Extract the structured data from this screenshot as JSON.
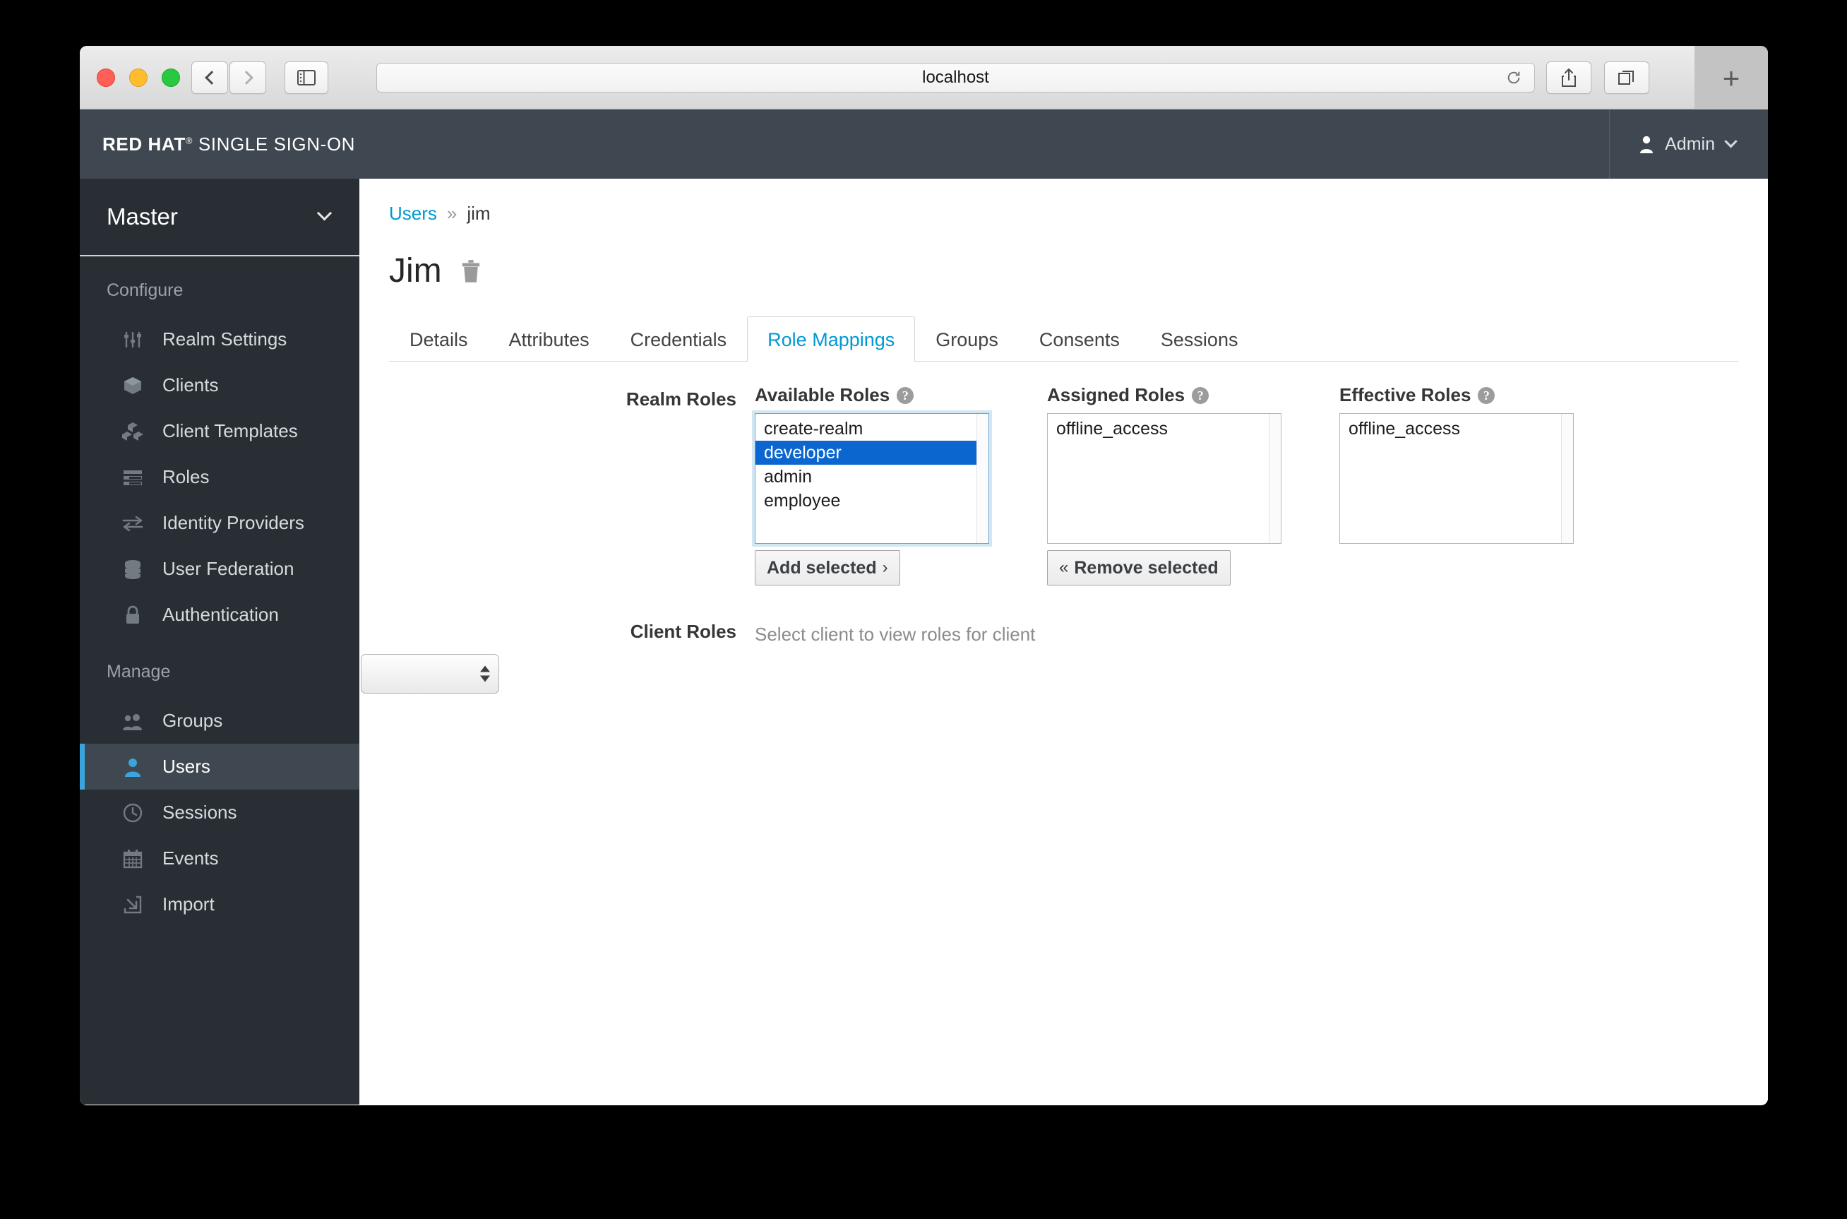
{
  "browser": {
    "url": "localhost",
    "back_icon": "chevron-left-icon",
    "forward_icon": "chevron-right-icon",
    "sidebar_icon": "sidebar-toggle-icon",
    "reload_icon": "reload-icon",
    "share_icon": "share-icon",
    "tabs_icon": "show-tabs-icon",
    "new_tab_label": "+"
  },
  "header": {
    "brand_bold": "RED HAT",
    "brand_sup": "®",
    "brand_regular": "SINGLE SIGN-ON",
    "user_label": "Admin",
    "user_icon": "user-icon",
    "caret_icon": "chevron-down-icon"
  },
  "sidebar": {
    "realm": "Master",
    "realm_caret_icon": "chevron-down-icon",
    "groups": [
      {
        "title": "Configure",
        "items": [
          {
            "label": "Realm Settings",
            "icon": "sliders-icon",
            "active": false
          },
          {
            "label": "Clients",
            "icon": "cube-icon",
            "active": false
          },
          {
            "label": "Client Templates",
            "icon": "cubes-icon",
            "active": false
          },
          {
            "label": "Roles",
            "icon": "list-bars-icon",
            "active": false
          },
          {
            "label": "Identity Providers",
            "icon": "exchange-arrows-icon",
            "active": false
          },
          {
            "label": "User Federation",
            "icon": "database-icon",
            "active": false
          },
          {
            "label": "Authentication",
            "icon": "lock-icon",
            "active": false
          }
        ]
      },
      {
        "title": "Manage",
        "items": [
          {
            "label": "Groups",
            "icon": "users-group-icon",
            "active": false
          },
          {
            "label": "Users",
            "icon": "user-icon",
            "active": true
          },
          {
            "label": "Sessions",
            "icon": "clock-icon",
            "active": false
          },
          {
            "label": "Events",
            "icon": "calendar-icon",
            "active": false
          },
          {
            "label": "Import",
            "icon": "import-arrow-icon",
            "active": false
          }
        ]
      }
    ]
  },
  "content": {
    "breadcrumb": {
      "parent": "Users",
      "separator": "»",
      "current": "jim"
    },
    "page_title": "Jim",
    "delete_icon": "trash-icon",
    "tabs": [
      {
        "label": "Details",
        "active": false
      },
      {
        "label": "Attributes",
        "active": false
      },
      {
        "label": "Credentials",
        "active": false
      },
      {
        "label": "Role Mappings",
        "active": true
      },
      {
        "label": "Groups",
        "active": false
      },
      {
        "label": "Consents",
        "active": false
      },
      {
        "label": "Sessions",
        "active": false
      }
    ],
    "realm_roles": {
      "label": "Realm Roles",
      "available": {
        "label": "Available Roles",
        "help_icon": "question-circle-icon",
        "items": [
          "create-realm",
          "developer",
          "admin",
          "employee"
        ],
        "selected": [
          "developer"
        ],
        "focused": true
      },
      "add_button": {
        "label": "Add selected",
        "arrow": "›"
      },
      "assigned": {
        "label": "Assigned Roles",
        "help_icon": "question-circle-icon",
        "items": [
          "offline_access"
        ],
        "selected": []
      },
      "remove_button": {
        "arrow": "«",
        "label": "Remove selected"
      },
      "effective": {
        "label": "Effective Roles",
        "help_icon": "question-circle-icon",
        "items": [
          "offline_access"
        ],
        "selected": []
      }
    },
    "client_roles": {
      "label": "Client Roles",
      "select_value": "",
      "hint": "Select client to view roles for client"
    }
  },
  "colors": {
    "accent_blue": "#0099d3",
    "select_blue": "#0b66cf",
    "sidebar_bg": "#292e34",
    "header_bg": "#3f4750"
  }
}
